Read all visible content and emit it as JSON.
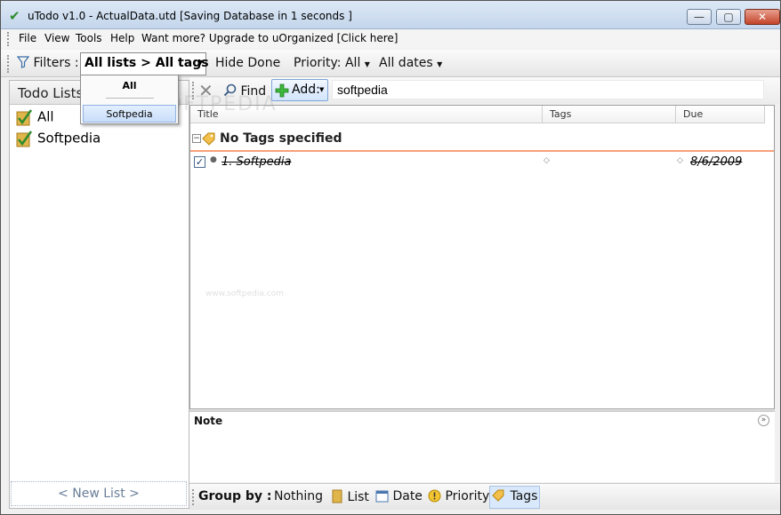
{
  "window": {
    "title": "uTodo v1.0 - ActualData.utd  [Saving Database in 1 seconds ]"
  },
  "menu": [
    "File",
    "View",
    "Tools",
    "Help",
    "Want more? Upgrade to uOrganized [Click here]"
  ],
  "filters": {
    "label": "Filters :",
    "lists_tags": "All lists > All tags",
    "hide_done": "Hide Done",
    "priority": "Priority: All",
    "dates": "All dates"
  },
  "tag_dropdown": {
    "items": [
      "All",
      "Softpedia"
    ],
    "selected": "Softpedia"
  },
  "left_panel": {
    "header": "Todo Lists",
    "items": [
      "All",
      "Softpedia"
    ],
    "new_list": "< New List >"
  },
  "toolbar": {
    "find": "Find",
    "add": "Add:",
    "search_value": "softpedia"
  },
  "columns": [
    "Title",
    "Tags",
    "Due"
  ],
  "group": {
    "label": "No Tags specified"
  },
  "tasks": [
    {
      "title": "1. Softpedia",
      "due": "8/6/2009",
      "done": true
    }
  ],
  "note": {
    "label": "Note"
  },
  "group_by": {
    "label": "Group by :",
    "options": [
      "Nothing",
      "List",
      "Date",
      "Priority",
      "Tags"
    ],
    "active": "Tags"
  },
  "watermark": "SOFTPEDIA",
  "watermark_url": "www.softpedia.com",
  "colors": {
    "accent": "#f7a07a",
    "selection": "#c9defa",
    "check_green": "#2e8b2e"
  }
}
